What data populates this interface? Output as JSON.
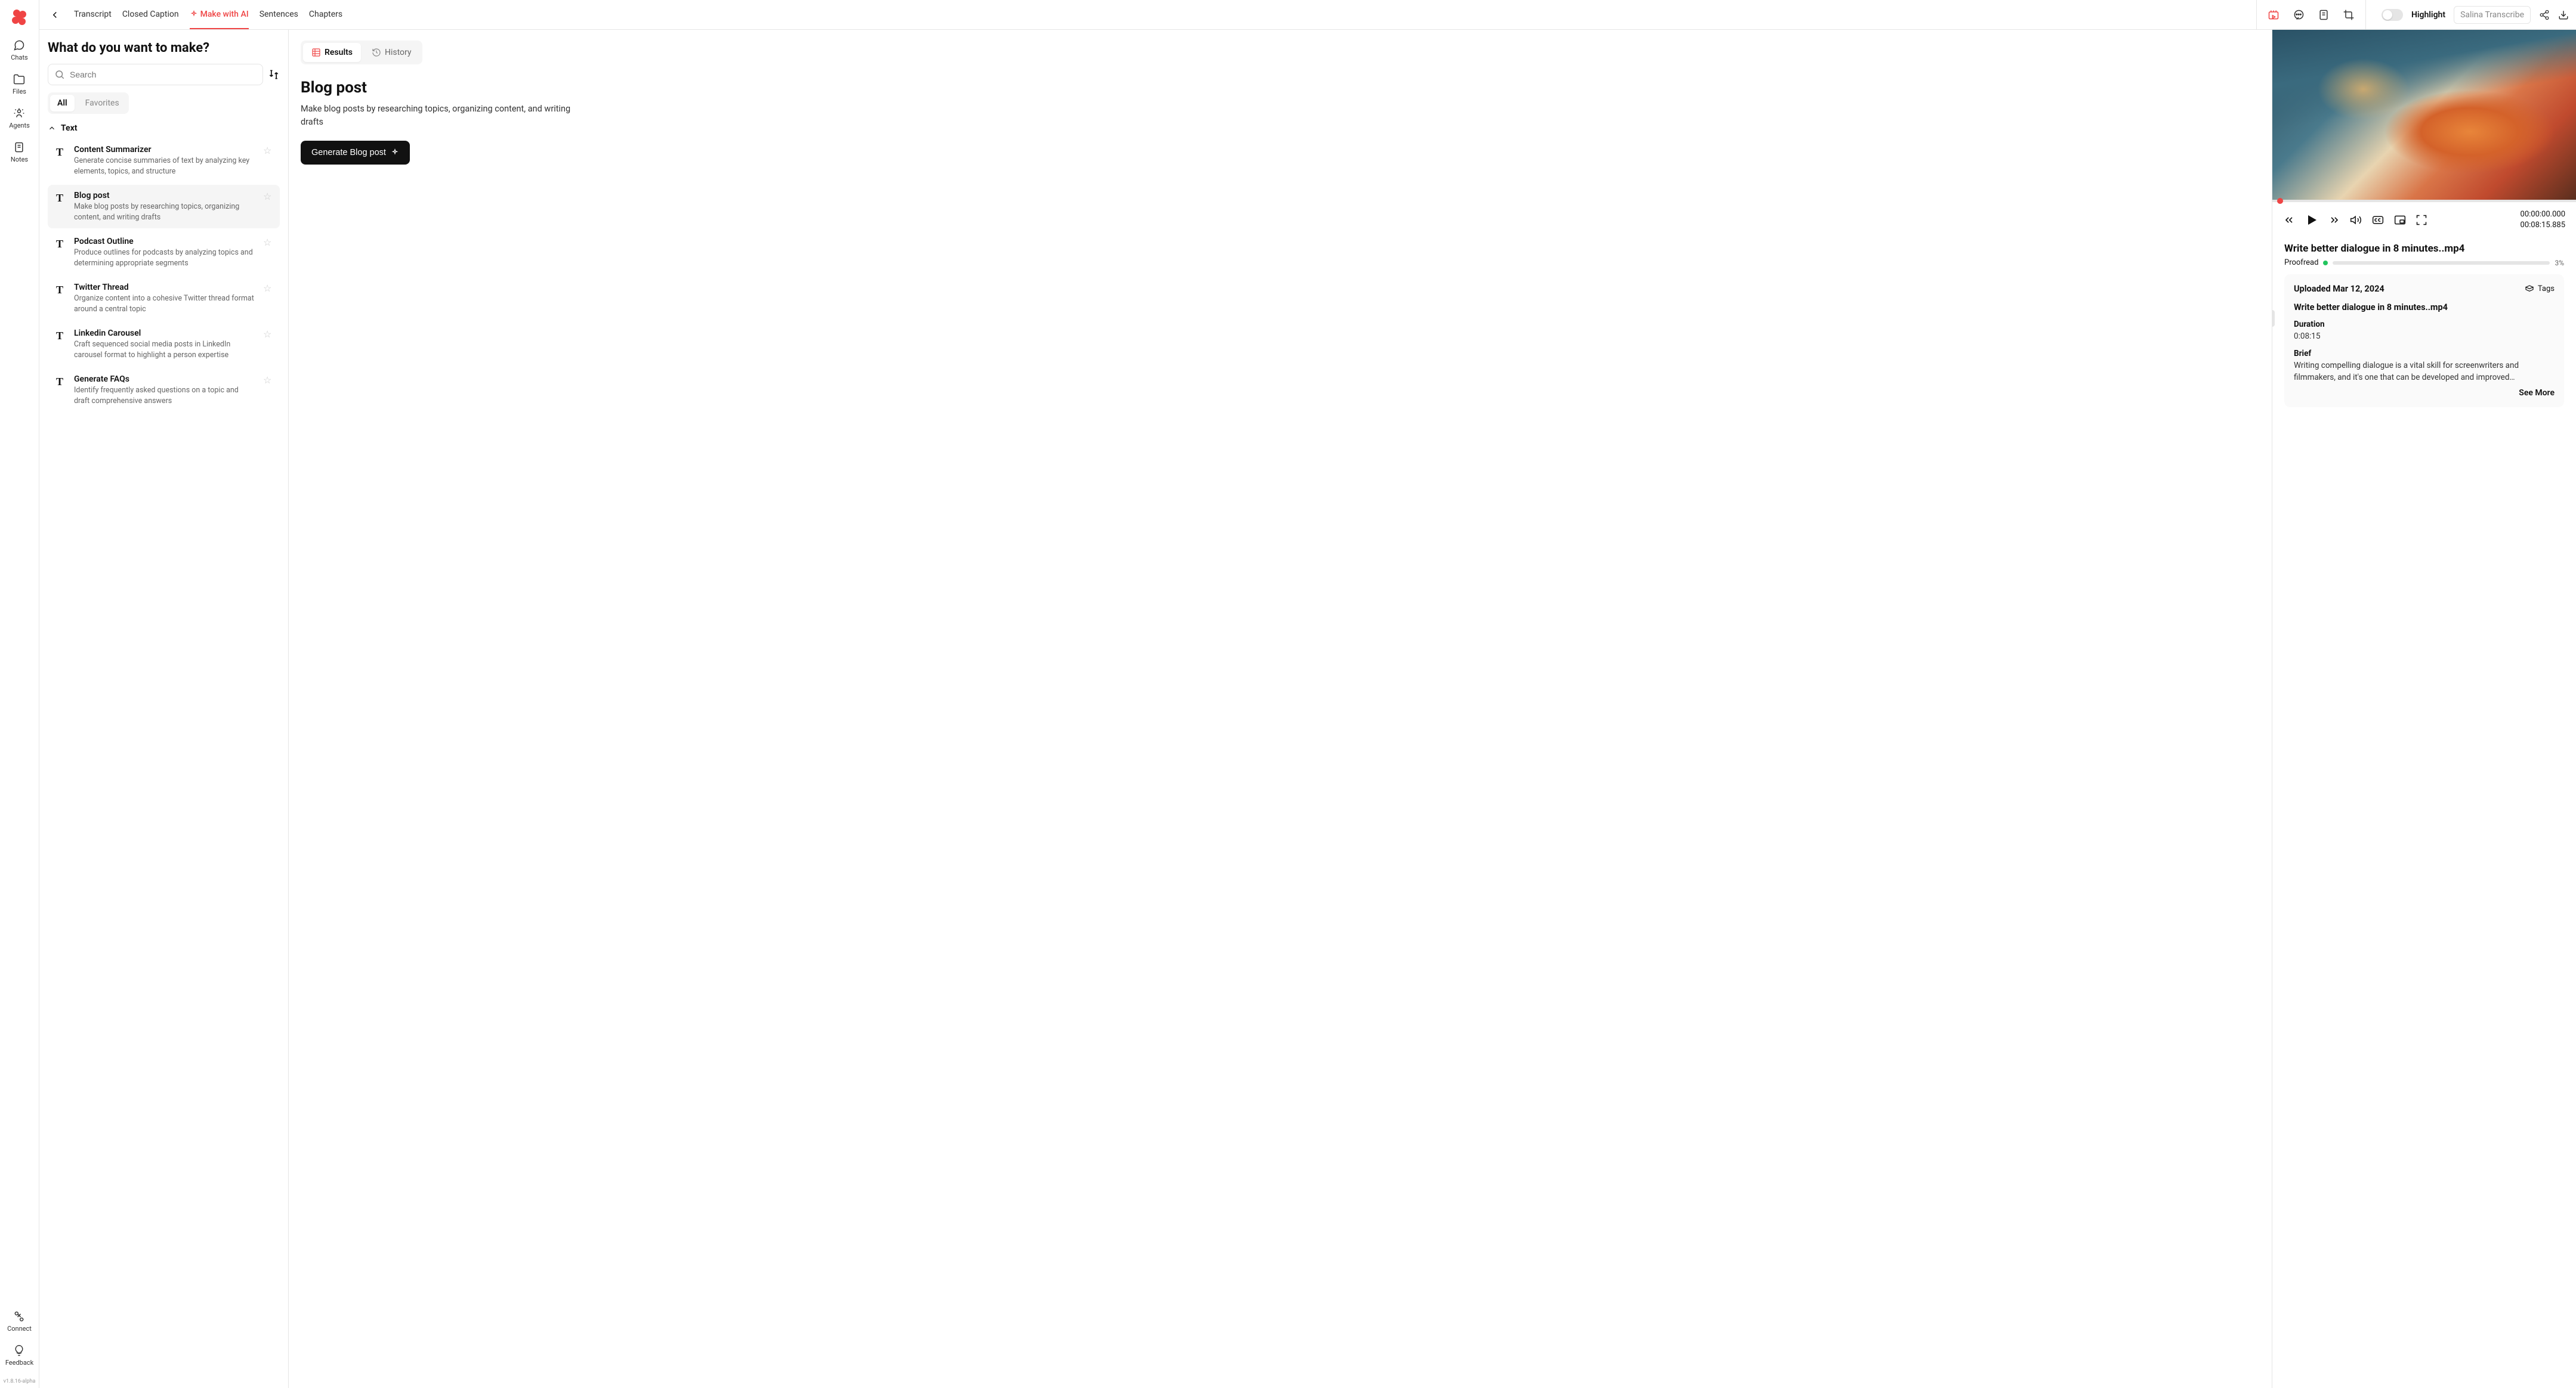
{
  "rail": {
    "items": [
      {
        "label": "Chats"
      },
      {
        "label": "Files"
      },
      {
        "label": "Agents"
      },
      {
        "label": "Notes"
      }
    ],
    "bottom": [
      {
        "label": "Connect"
      },
      {
        "label": "Feedback"
      }
    ],
    "version": "v1.8.16-alpha"
  },
  "topbar": {
    "tabs": [
      {
        "label": "Transcript"
      },
      {
        "label": "Closed Caption"
      },
      {
        "label": "Make with AI"
      },
      {
        "label": "Sentences"
      },
      {
        "label": "Chapters"
      }
    ],
    "highlight_label": "Highlight",
    "selector_label": "Salina Transcribe"
  },
  "left": {
    "heading": "What do you want to make?",
    "search_placeholder": "Search",
    "filter_all": "All",
    "filter_fav": "Favorites",
    "section": "Text",
    "templates": [
      {
        "title": "Content Summarizer",
        "desc": "Generate concise summaries of text by analyzing key elements, topics, and structure"
      },
      {
        "title": "Blog post",
        "desc": "Make blog posts by researching topics, organizing content, and writing drafts"
      },
      {
        "title": "Podcast Outline",
        "desc": "Produce outlines for podcasts by analyzing topics and determining appropriate segments"
      },
      {
        "title": "Twitter Thread",
        "desc": "Organize content into a cohesive Twitter thread format around a central topic"
      },
      {
        "title": "Linkedin Carousel",
        "desc": "Craft sequenced social media posts in LinkedIn carousel format to highlight a person expertise"
      },
      {
        "title": "Generate FAQs",
        "desc": "Identify frequently asked questions on a topic and draft comprehensive answers"
      }
    ]
  },
  "mid": {
    "seg_results": "Results",
    "seg_history": "History",
    "title": "Blog post",
    "desc": "Make blog posts by researching topics, organizing content, and writing drafts",
    "generate_label": "Generate Blog post"
  },
  "right": {
    "time_current": "00:00:00.000",
    "time_total": "00:08:15.885",
    "video_title": "Write better dialogue in 8 minutes..mp4",
    "proofread_label": "Proofread",
    "proofread_pct": "3%",
    "uploaded": "Uploaded Mar 12, 2024",
    "tags_label": "Tags",
    "file_name": "Write better dialogue in 8 minutes..mp4",
    "duration_label": "Duration",
    "duration_value": "0:08:15",
    "brief_label": "Brief",
    "brief_value": "Writing compelling dialogue is a vital skill for screenwriters and filmmakers, and it's one that can be developed and improved…",
    "see_more": "See More"
  }
}
